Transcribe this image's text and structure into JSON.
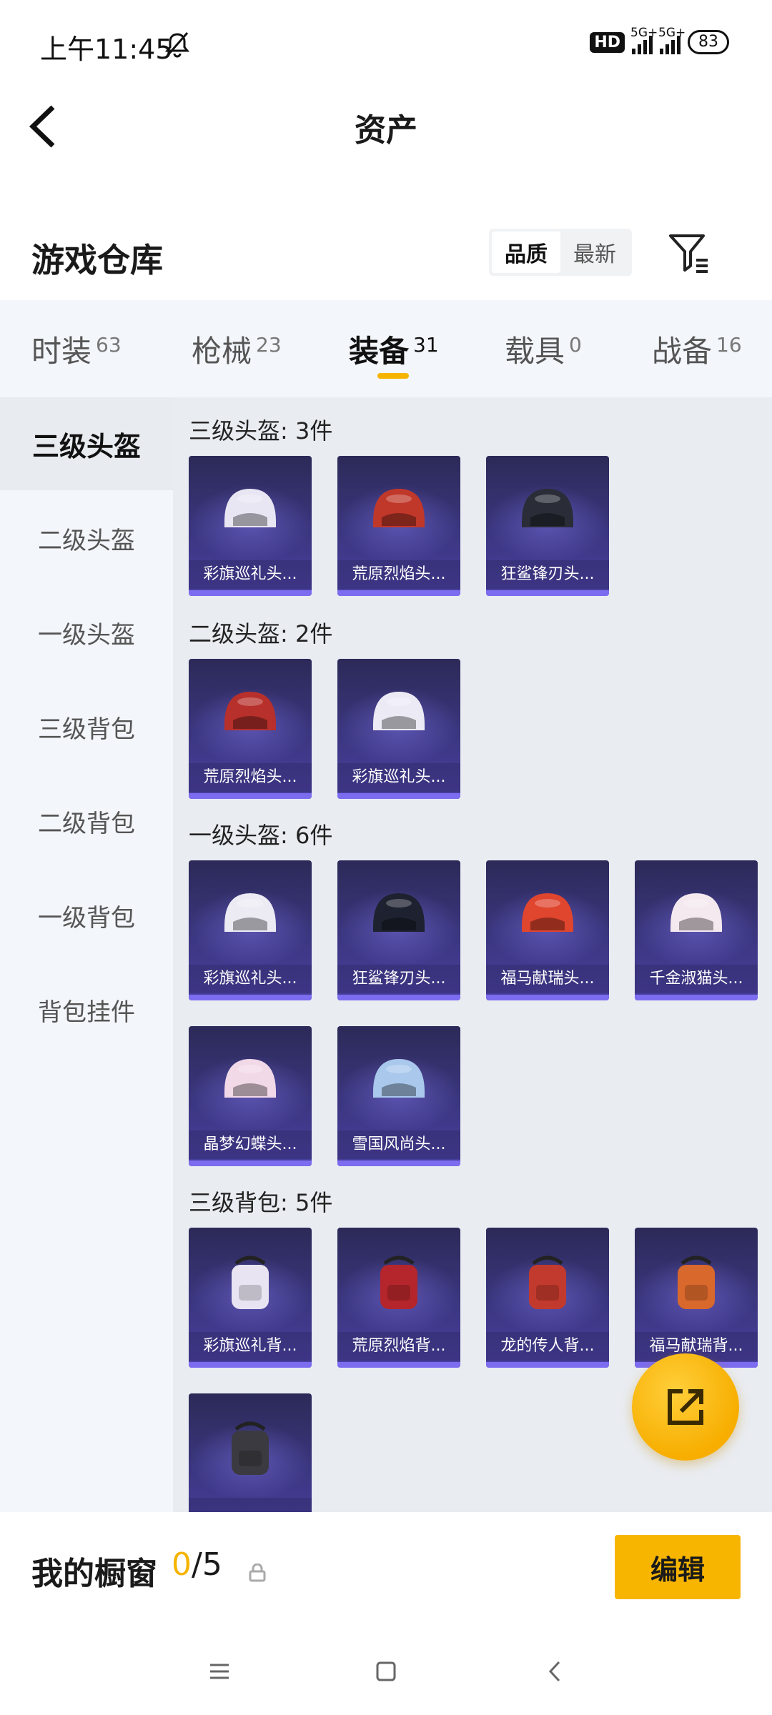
{
  "status": {
    "time": "上午11:45",
    "hd": "HD",
    "net1": "5G+",
    "net2": "5G+",
    "battery": "83"
  },
  "header": {
    "title": "资产"
  },
  "warehouse": {
    "title": "游戏仓库",
    "sort_options": [
      "品质",
      "最新"
    ],
    "active_sort": "品质"
  },
  "tabs": [
    {
      "label": "时装",
      "count": "63"
    },
    {
      "label": "枪械",
      "count": "23"
    },
    {
      "label": "装备",
      "count": "31"
    },
    {
      "label": "载具",
      "count": "0"
    },
    {
      "label": "战备",
      "count": "16"
    }
  ],
  "active_tab": "装备",
  "menu": [
    "三级头盔",
    "二级头盔",
    "一级头盔",
    "三级背包",
    "二级背包",
    "一级背包",
    "背包挂件"
  ],
  "active_menu": "三级头盔",
  "sections": {
    "s1": {
      "title": "三级头盔: 3件",
      "items": [
        "彩旗巡礼头...",
        "荒原烈焰头...",
        "狂鲨锋刃头..."
      ]
    },
    "s2": {
      "title": "二级头盔: 2件",
      "items": [
        "荒原烈焰头...",
        "彩旗巡礼头..."
      ]
    },
    "s3": {
      "title": "一级头盔: 6件",
      "items": [
        "彩旗巡礼头...",
        "狂鲨锋刃头...",
        "福马献瑞头...",
        "千金淑猫头...",
        "晶梦幻蝶头...",
        "雪国风尚头..."
      ]
    },
    "s4": {
      "title": "三级背包: 5件",
      "items": [
        "彩旗巡礼背...",
        "荒原烈焰背...",
        "龙的传人背...",
        "福马献瑞背...",
        ""
      ]
    }
  },
  "item_colors": {
    "s1": [
      "#e9e6f3",
      "#c0382a",
      "#2a2d38"
    ],
    "s2": [
      "#b7302b",
      "#eceaf4"
    ],
    "s3": [
      "#ecebf4",
      "#1e2230",
      "#e0452e",
      "#f4e9ef",
      "#f2d9e8",
      "#a9c8ec"
    ],
    "s4": [
      "#e8e4f2",
      "#b4262b",
      "#c23a2d",
      "#d8682b",
      "#3b3a40"
    ]
  },
  "showcase": {
    "label": "我的橱窗",
    "used": "0",
    "total": "/5",
    "edit": "编辑"
  },
  "colors": {
    "accent": "#f7b500",
    "card_bg": "#3b3680"
  }
}
